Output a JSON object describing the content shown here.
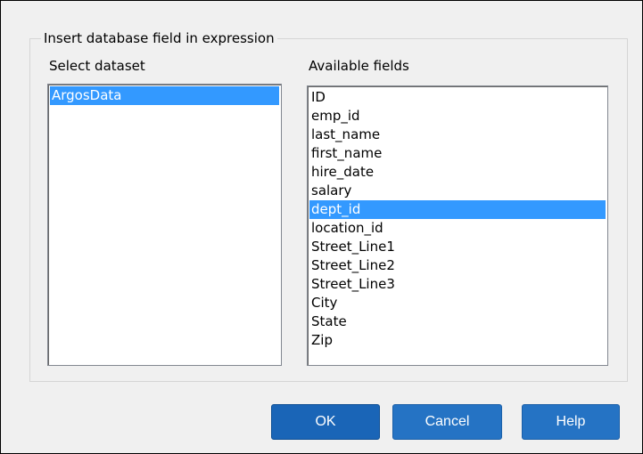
{
  "dialog": {
    "group_title": "Insert database field in expression"
  },
  "datasets": {
    "label": "Select dataset",
    "items": [
      {
        "label": "ArgosData",
        "selected": true
      }
    ]
  },
  "fields": {
    "label": "Available fields",
    "items": [
      {
        "label": "ID",
        "selected": false
      },
      {
        "label": "emp_id",
        "selected": false
      },
      {
        "label": "last_name",
        "selected": false
      },
      {
        "label": "first_name",
        "selected": false
      },
      {
        "label": "hire_date",
        "selected": false
      },
      {
        "label": "salary",
        "selected": false
      },
      {
        "label": "dept_id",
        "selected": true
      },
      {
        "label": "location_id",
        "selected": false
      },
      {
        "label": "Street_Line1",
        "selected": false
      },
      {
        "label": "Street_Line2",
        "selected": false
      },
      {
        "label": "Street_Line3",
        "selected": false
      },
      {
        "label": "City",
        "selected": false
      },
      {
        "label": "State",
        "selected": false
      },
      {
        "label": "Zip",
        "selected": false
      }
    ]
  },
  "buttons": {
    "ok": "OK",
    "cancel": "Cancel",
    "help": "Help"
  },
  "colors": {
    "selection": "#3399ff",
    "button": "#2573c4",
    "button_default": "#1a65b7",
    "dialog_bg": "#f0f0f0"
  }
}
